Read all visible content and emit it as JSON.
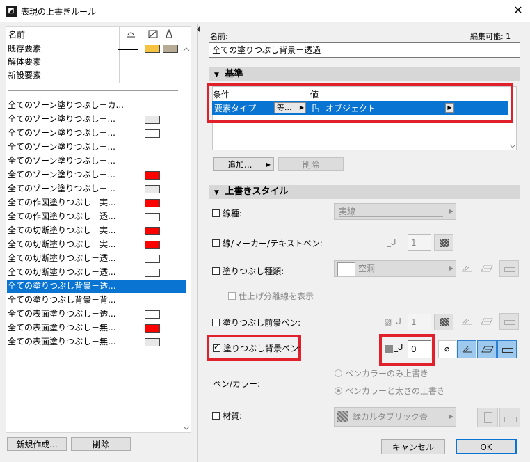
{
  "window": {
    "title": "表現の上書きルール",
    "close": "✕"
  },
  "left": {
    "header": "名前",
    "groups": [
      "既存要素",
      "解体要素",
      "新設要素"
    ],
    "rules": [
      {
        "name": "全てのゾーン塗りつぶし－カ...",
        "swatch": ""
      },
      {
        "name": "全てのゾーン塗りつぶし－...",
        "swatch": "#e8e8e8"
      },
      {
        "name": "全てのゾーン塗りつぶし－...",
        "swatch": "#ffffff"
      },
      {
        "name": "全てのゾーン塗りつぶし－...",
        "swatch": ""
      },
      {
        "name": "全てのゾーン塗りつぶし－...",
        "swatch": ""
      },
      {
        "name": "全てのゾーン塗りつぶし－...",
        "swatch": "#ff0000"
      },
      {
        "name": "全てのゾーン塗りつぶし－...",
        "swatch": "#e8e8e8"
      },
      {
        "name": "全ての作図塗りつぶし－実...",
        "swatch": "#ff0000"
      },
      {
        "name": "全ての作図塗りつぶし－透...",
        "swatch": "#ffffff"
      },
      {
        "name": "全ての切断塗りつぶし－実...",
        "swatch": "#ff0000"
      },
      {
        "name": "全ての切断塗りつぶし－実...",
        "swatch": "#ff0000"
      },
      {
        "name": "全ての切断塗りつぶし－透...",
        "swatch": "#ffffff"
      },
      {
        "name": "全ての切断塗りつぶし－透...",
        "swatch": "#ffffff"
      },
      {
        "name": "全ての塗りつぶし背景－透...",
        "swatch": "",
        "selected": true
      },
      {
        "name": "全ての塗りつぶし背景－背...",
        "swatch": ""
      },
      {
        "name": "全ての表面塗りつぶし－透...",
        "swatch": "#ffffff"
      },
      {
        "name": "全ての表面塗りつぶし－無...",
        "swatch": "#ff0000"
      },
      {
        "name": "全ての表面塗りつぶし－無...",
        "swatch": "#e8e8e8"
      }
    ],
    "new_button": "新規作成...",
    "delete_button": "削除"
  },
  "right": {
    "name_label": "名前:",
    "editable_label": "編集可能: 1",
    "name_value": "全ての塗りつぶし背景－透過",
    "criteria_section": "基準",
    "col_condition": "条件",
    "col_value": "値",
    "criteria_row": {
      "condition": "要素タイプ",
      "operator": "等...",
      "value": "オブジェクト"
    },
    "add_button": "追加...",
    "remove_button": "削除",
    "style_section": "上書きスタイル",
    "line_type_label": "線種:",
    "line_type_value": "実線",
    "line_pen_label": "線/マーカー/テキストペン:",
    "line_pen_value": "1",
    "fill_type_label": "塗りつぶし種類:",
    "fill_type_value": "空洞",
    "show_separator_label": "仕上げ分離線を表示",
    "fill_fg_label": "塗りつぶし前景ペン:",
    "fill_fg_value": "1",
    "fill_bg_label": "塗りつぶし背景ペン:",
    "fill_bg_value": "0",
    "pen_color_label": "ペン/カラー:",
    "radio_color_only": "ペンカラーのみ上書き",
    "radio_color_weight": "ペンカラーと太さの上書き",
    "material_label": "材質:",
    "material_value": "緑カルタブリック畳",
    "cancel_button": "キャンセル",
    "ok_button": "OK"
  },
  "colors": {
    "accent": "#0a74d2",
    "highlight": "#e0202b"
  }
}
